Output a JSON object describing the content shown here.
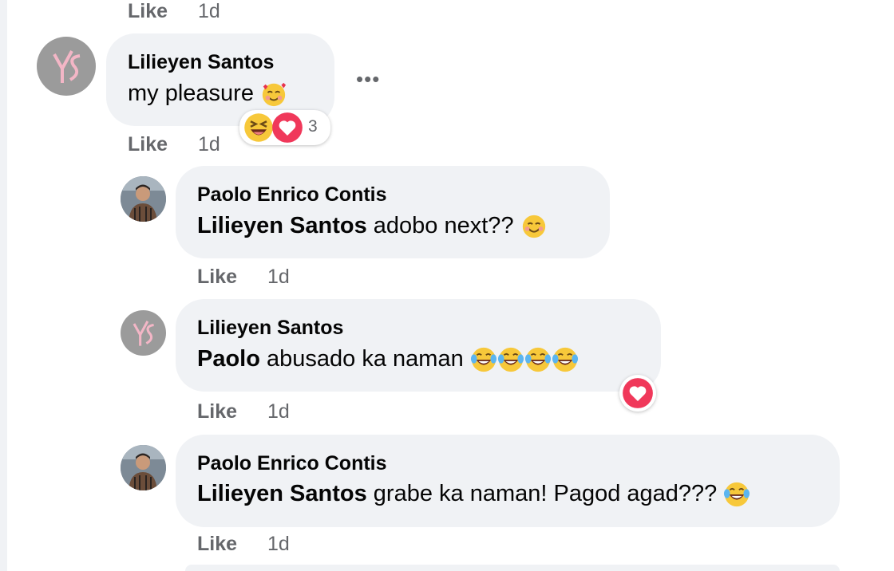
{
  "top": {
    "like_label": "Like",
    "time": "1d"
  },
  "comments": [
    {
      "author": "Lilieyen Santos",
      "text": "my pleasure",
      "more_label": "•••",
      "reaction_count": "3",
      "like_label": "Like",
      "time": "1d"
    },
    {
      "author": "Paolo Enrico Contis",
      "mention": "Lilieyen Santos",
      "text": "adobo next??",
      "like_label": "Like",
      "time": "1d"
    },
    {
      "author": "Lilieyen Santos",
      "mention": "Paolo",
      "text": "abusado ka naman",
      "like_label": "Like",
      "time": "1d"
    },
    {
      "author": "Paolo Enrico Contis",
      "mention": "Lilieyen Santos",
      "text": "grabe ka naman! Pagod agad???",
      "like_label": "Like",
      "time": "1d"
    }
  ],
  "colors": {
    "bubble": "#f0f2f5",
    "meta_text": "#65676b",
    "heart": "#f0385a",
    "emoji_yellow": "#f7c83a"
  },
  "icons": [
    "smiling-face-with-hearts-icon",
    "laughing-face-icon",
    "heart-icon",
    "smiling-face-icon",
    "tears-of-joy-icon",
    "more-options-icon"
  ]
}
